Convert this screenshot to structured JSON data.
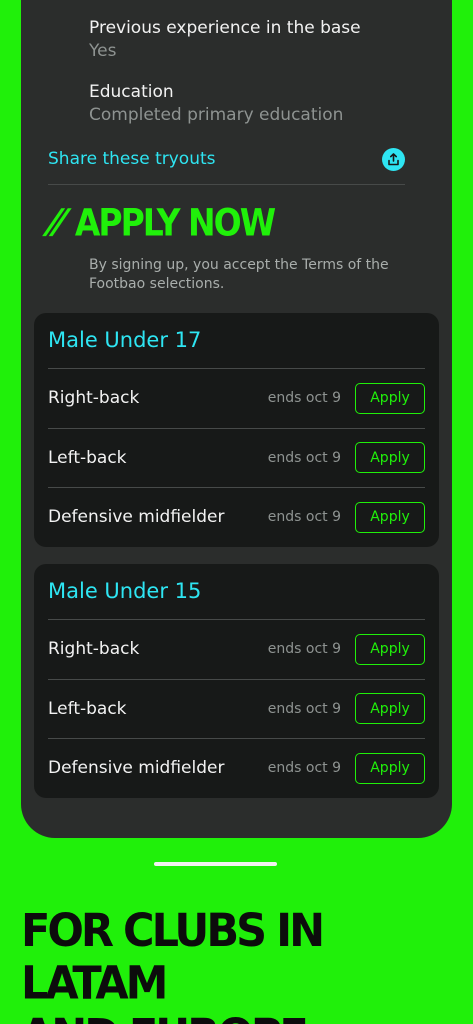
{
  "profile": {
    "experience_label": "Previous experience in the base",
    "experience_value": "Yes",
    "education_label": "Education",
    "education_value": "Completed primary education"
  },
  "share": {
    "label": "Share these tryouts",
    "icon": "share-upload-icon"
  },
  "apply_section": {
    "slashes": "//",
    "title": "APPLY NOW",
    "terms": "By signing up, you accept the Terms of the Footbao selections."
  },
  "categories": [
    {
      "title": "Male Under 17",
      "positions": [
        {
          "name": "Right-back",
          "ends": "ends oct 9",
          "button": "Apply"
        },
        {
          "name": "Left-back",
          "ends": "ends oct 9",
          "button": "Apply"
        },
        {
          "name": "Defensive midfielder",
          "ends": "ends oct 9",
          "button": "Apply"
        }
      ]
    },
    {
      "title": "Male Under 15",
      "positions": [
        {
          "name": "Right-back",
          "ends": "ends oct 9",
          "button": "Apply"
        },
        {
          "name": "Left-back",
          "ends": "ends oct 9",
          "button": "Apply"
        },
        {
          "name": "Defensive midfielder",
          "ends": "ends oct 9",
          "button": "Apply"
        }
      ]
    }
  ],
  "tagline": {
    "line1": "FOR CLUBS IN LATAM",
    "line2": "AND EUROPE"
  },
  "colors": {
    "accent_green": "#20F00A",
    "accent_cyan": "#2EE5F2",
    "panel": "#2B2D2C",
    "card": "#171918"
  }
}
